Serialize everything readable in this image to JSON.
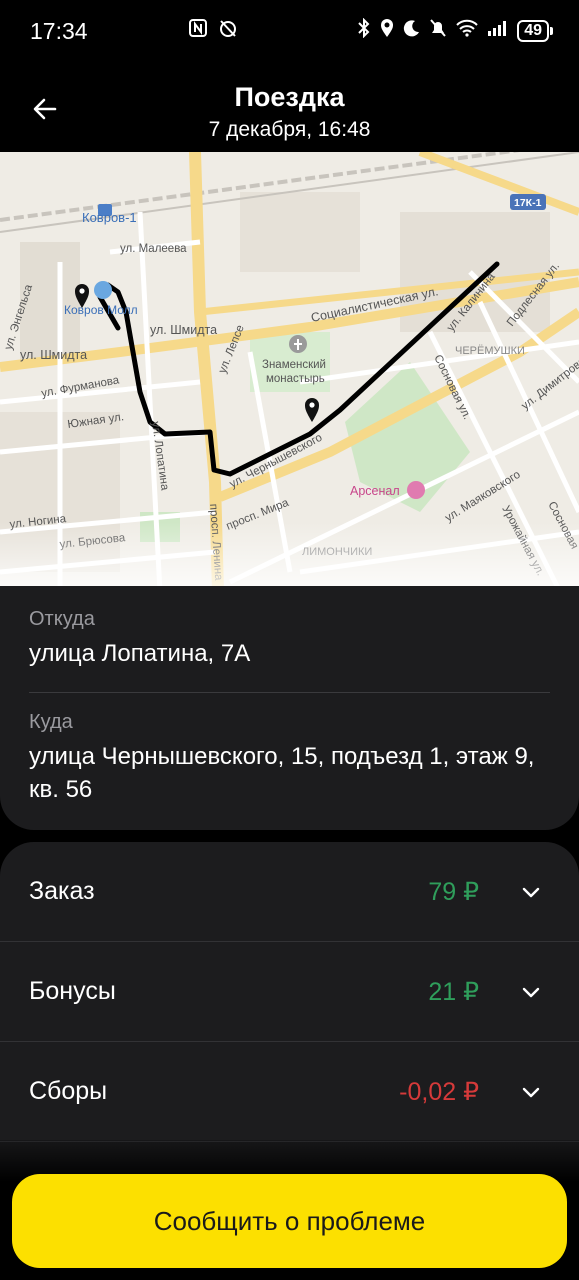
{
  "status_bar": {
    "time": "17:34",
    "battery": "49",
    "icons_left": [
      "nfc-icon",
      "alarm-off-icon"
    ],
    "icons_right": [
      "bluetooth-icon",
      "location-icon",
      "moon-icon",
      "bell-off-icon",
      "wifi-icon",
      "signal-icon"
    ]
  },
  "header": {
    "title": "Поездка",
    "subtitle": "7 декабря, 16:48"
  },
  "map": {
    "labels": {
      "kovrov1": "Ковров-1",
      "malееva": "ул. Малеева",
      "kovrov_mall": "Ковров Молл",
      "shmidta1": "ул. Шмидта",
      "shmidta2": "ул. Шмидта",
      "engelsa": "ул. Энгельса",
      "furmanova": "ул. Фурманова",
      "yuzhnaya": "Южная ул.",
      "lopatina": "ул. Лопатина",
      "lepse": "ул. Лепсе",
      "socialist": "Социалистическая ул.",
      "monastery1": "Знаменский",
      "monastery2": "монастырь",
      "kalinina": "ул. Калинина",
      "podlesnaya": "Подлесная ул.",
      "cheremushki": "ЧЕРЁМУШКИ",
      "sosnovaya": "Сосновая ул.",
      "dimitrova": "ул. Димитрова",
      "chernyshevsky": "ул. Чернышевского",
      "arsenal": "Арсенал",
      "mira": "просп. Мира",
      "mayakovskogo": "ул. Маяковского",
      "urozhainaya": "Урожайная ул.",
      "sosnovaya2": "Сосновая",
      "nogina": "ул. Ногина",
      "bryusova": "ул. Брюсова",
      "lenina": "просп. Ленина",
      "limonchiki": "ЛИМОНЧИКИ",
      "road_badge": "17К-1"
    }
  },
  "addresses": {
    "from_label": "Откуда",
    "from_value": "улица Лопатина, 7А",
    "to_label": "Куда",
    "to_value": "улица Чернышевского, 15, подъезд 1, этаж 9, кв. 56"
  },
  "costs": [
    {
      "label": "Заказ",
      "value": "79 ₽",
      "color": "#2f9e5b"
    },
    {
      "label": "Бонусы",
      "value": "21 ₽",
      "color": "#2f9e5b"
    },
    {
      "label": "Сборы",
      "value": "-0,02 ₽",
      "color": "#d63a3a"
    }
  ],
  "report_button": "Сообщить о проблеме"
}
